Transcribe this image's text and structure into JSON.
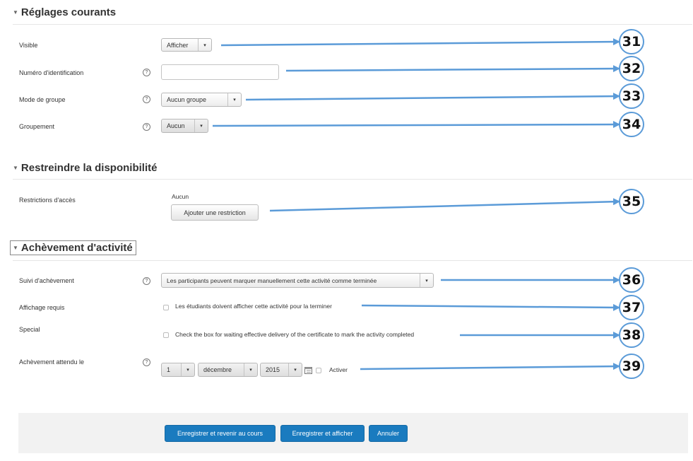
{
  "sections": {
    "common": {
      "title": "Réglages courants"
    },
    "restrict": {
      "title": "Restreindre la disponibilité"
    },
    "completion": {
      "title": "Achèvement d'activité"
    }
  },
  "fields": {
    "visible": {
      "label": "Visible",
      "value": "Afficher"
    },
    "idnumber": {
      "label": "Numéro d'identification",
      "value": ""
    },
    "groupmode": {
      "label": "Mode de groupe",
      "value": "Aucun groupe"
    },
    "grouping": {
      "label": "Groupement",
      "value": "Aucun"
    },
    "access": {
      "label": "Restrictions d'accès",
      "status": "Aucun",
      "button": "Ajouter une restriction"
    },
    "tracking": {
      "label": "Suivi d'achèvement",
      "value": "Les participants peuvent marquer manuellement cette activité comme terminée"
    },
    "view_required": {
      "label": "Affichage requis",
      "checkbox_label": "Les étudiants doivent afficher cette activité pour la terminer"
    },
    "special": {
      "label": "Special",
      "checkbox_label": "Check the box for waiting effective delivery of the certificate to mark the activity completed"
    },
    "expected": {
      "label": "Achèvement attendu le",
      "day": "1",
      "month": "décembre",
      "year": "2015",
      "enable_label": "Activer"
    }
  },
  "help_icon": "?",
  "footer": {
    "save_return": "Enregistrer et revenir au cours",
    "save_display": "Enregistrer et afficher",
    "cancel": "Annuler"
  },
  "callouts": [
    "31",
    "32",
    "33",
    "34",
    "35",
    "36",
    "37",
    "38",
    "39"
  ],
  "colors": {
    "arrow": "#5b9bd8",
    "primary_button": "#1a7bbf"
  },
  "icons": {
    "collapse": "triangle-down-icon",
    "help": "question-circle-icon",
    "calendar": "calendar-icon",
    "dropdown": "chevron-down-icon"
  }
}
